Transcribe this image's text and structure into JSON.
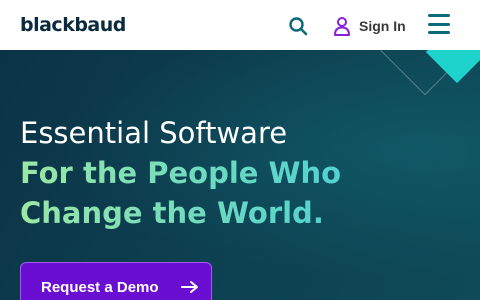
{
  "header": {
    "logo_text": "blackbaud",
    "sign_in_label": "Sign In"
  },
  "icons": {
    "search": "search-icon",
    "user": "user-icon",
    "menu": "hamburger-menu-icon",
    "arrow": "arrow-right-icon"
  },
  "hero": {
    "title": "Essential Software",
    "subtitle": "For the People Who Change the World.",
    "cta_label": "Request a Demo"
  },
  "colors": {
    "header_bg": "#ffffff",
    "logo": "#0a2a3d",
    "icon_teal": "#0a6a7a",
    "user_purple": "#8a1fd6",
    "hero_bg": "#0c3a4e",
    "cta_bg": "#6a0fd1",
    "accent_teal": "#1ed3cc"
  }
}
